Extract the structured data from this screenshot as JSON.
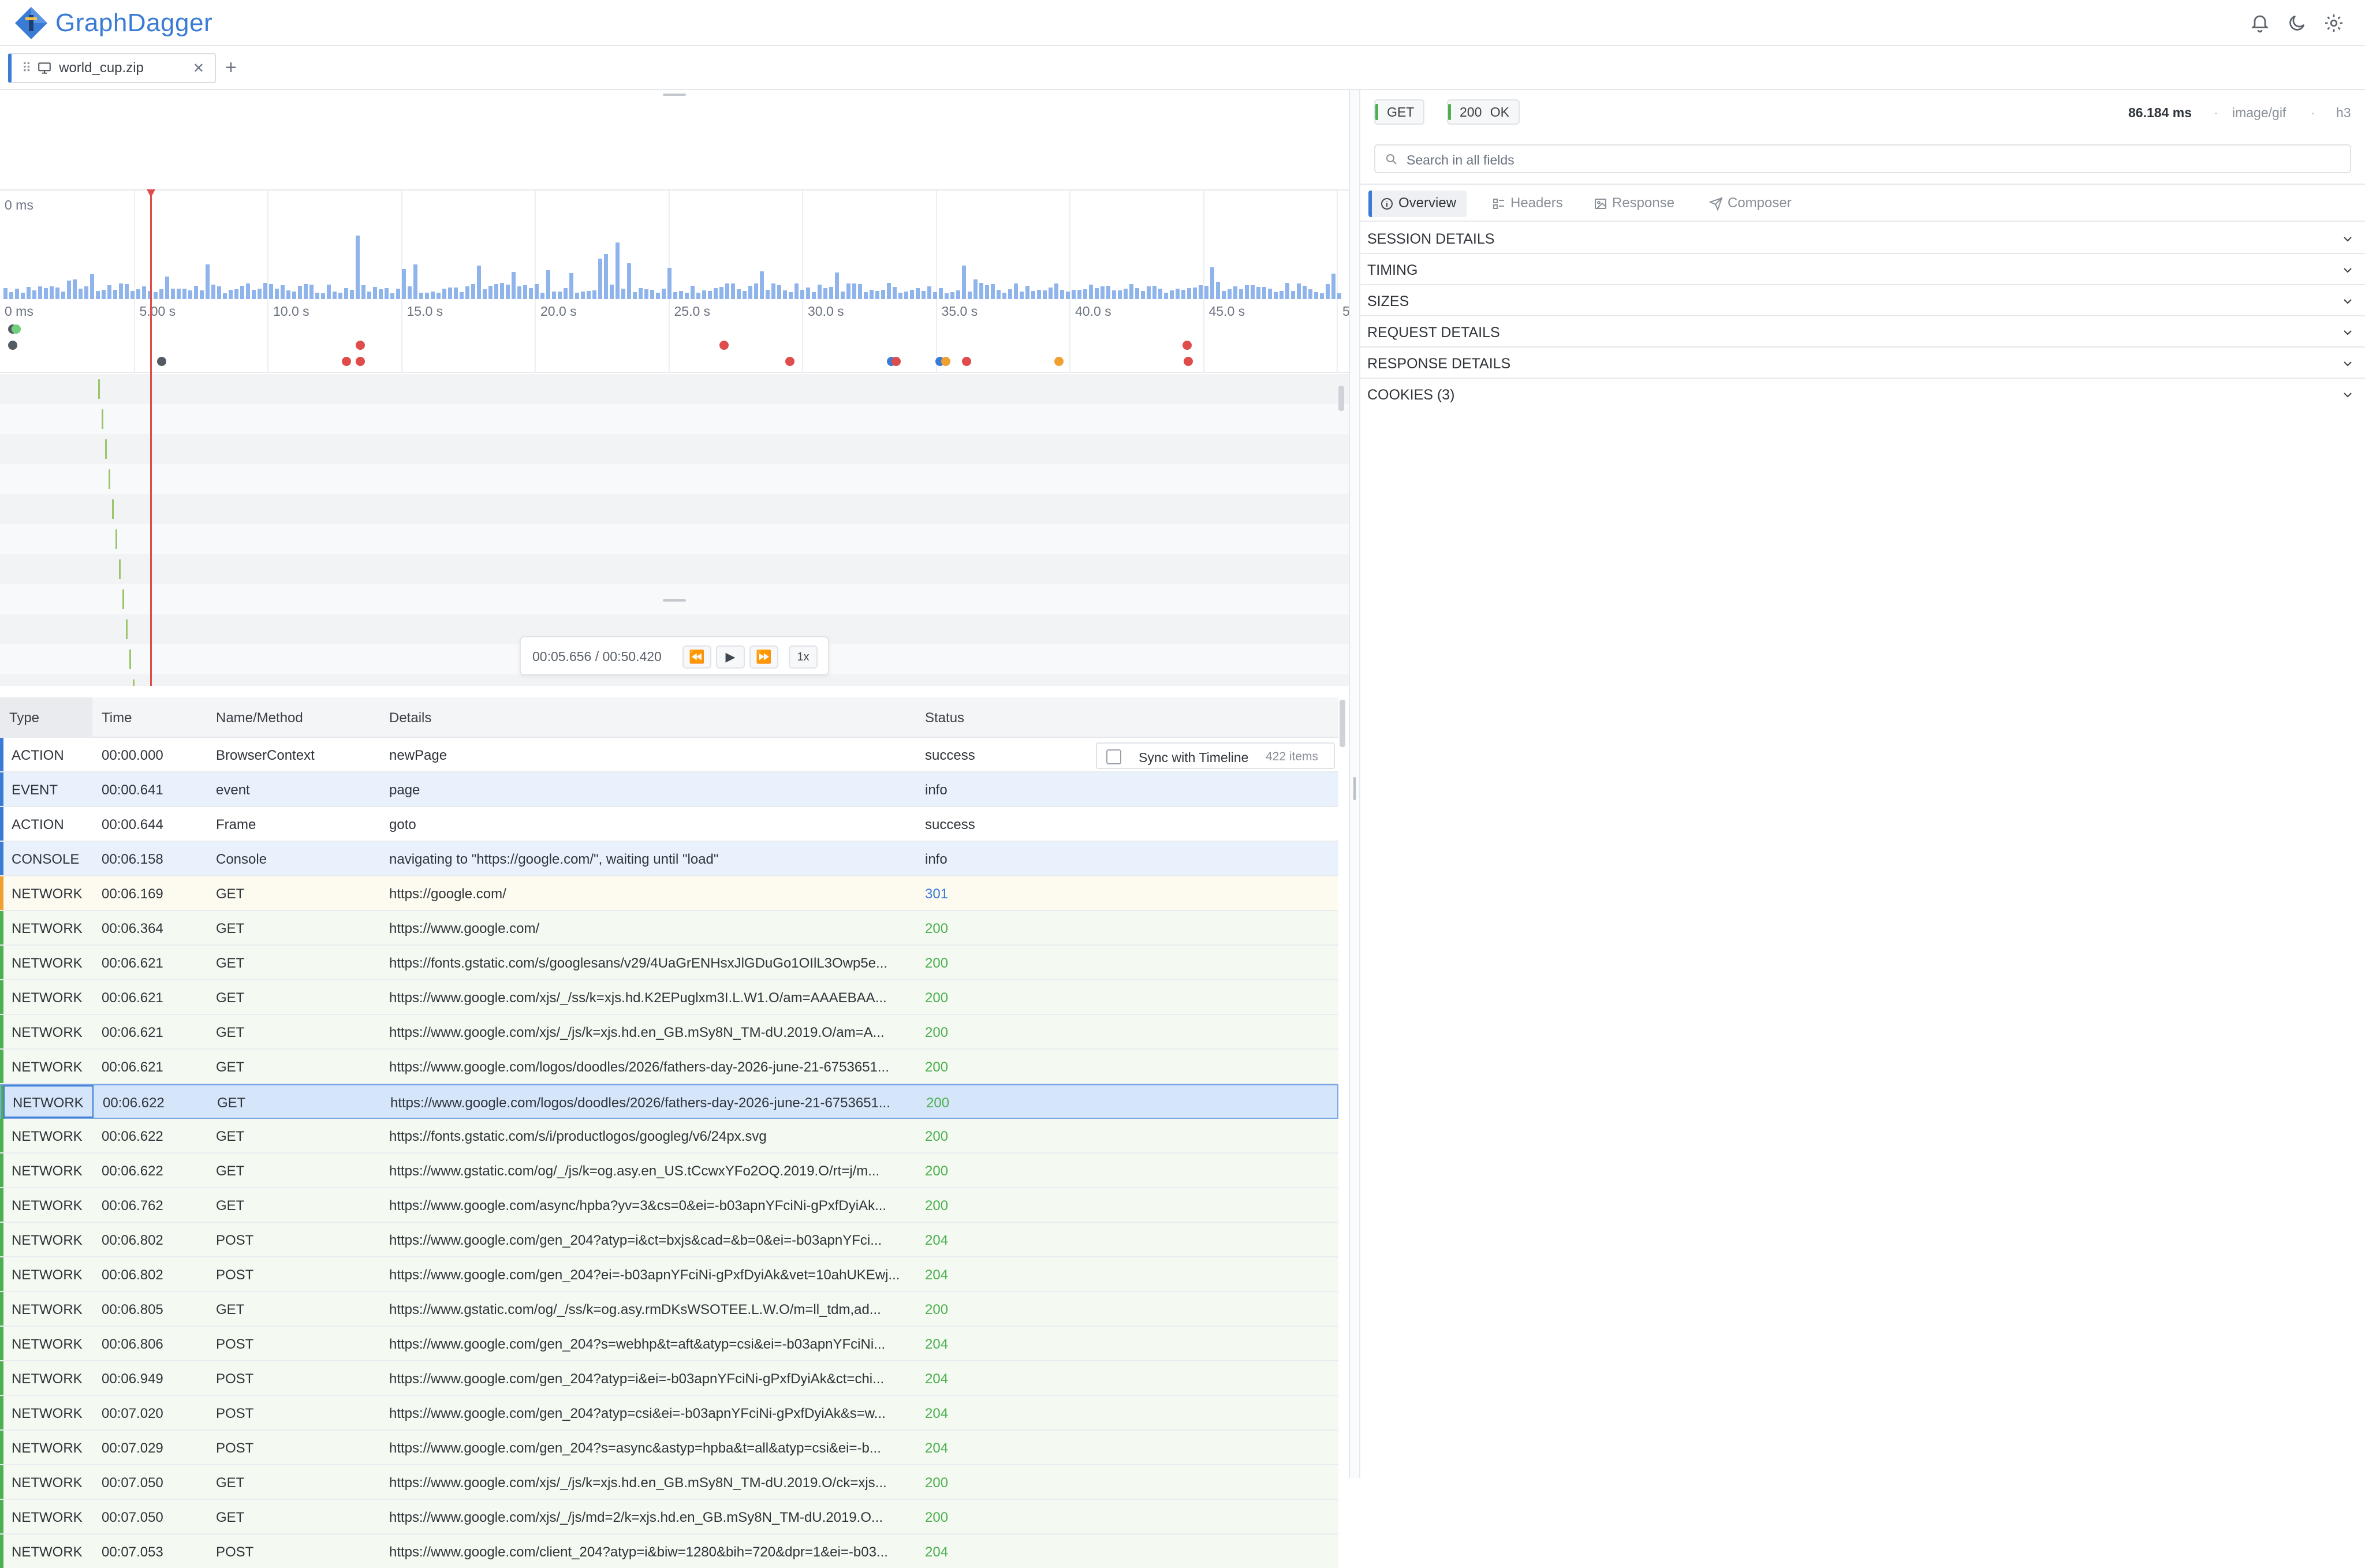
{
  "app": {
    "name": "GraphDagger"
  },
  "header_icons": [
    "bell-icon",
    "moon-icon",
    "gear-icon"
  ],
  "file_tab": {
    "label": "world_cup.zip"
  },
  "timeline": {
    "top_label": "0 ms",
    "ticks": [
      "0 ms",
      "5.00 s",
      "10.0 s",
      "15.0 s",
      "20.0 s",
      "25.0 s",
      "30.0 s",
      "35.0 s",
      "40.0 s",
      "45.0 s",
      "5"
    ]
  },
  "player": {
    "time": "00:05.656 / 00:50.420",
    "speed": "1x"
  },
  "table": {
    "columns": [
      "Type",
      "Time",
      "Name/Method",
      "Details",
      "Status"
    ],
    "sync_label": "Sync with Timeline",
    "items_count": "422 items",
    "rows": [
      {
        "type": "ACTION",
        "time": "00:00.000",
        "name": "BrowserContext",
        "details": "newPage",
        "status": "success"
      },
      {
        "type": "EVENT",
        "time": "00:00.641",
        "name": "event",
        "details": "page",
        "status": "info"
      },
      {
        "type": "ACTION",
        "time": "00:00.644",
        "name": "Frame",
        "details": "goto",
        "status": "success"
      },
      {
        "type": "CONSOLE",
        "time": "00:06.158",
        "name": "Console",
        "details": "navigating to \"https://google.com/\", waiting until \"load\"",
        "status": "info"
      },
      {
        "type": "NETWORK",
        "time": "00:06.169",
        "name": "GET",
        "details": "https://google.com/",
        "status": "301"
      },
      {
        "type": "NETWORK",
        "time": "00:06.364",
        "name": "GET",
        "details": "https://www.google.com/",
        "status": "200"
      },
      {
        "type": "NETWORK",
        "time": "00:06.621",
        "name": "GET",
        "details": "https://fonts.gstatic.com/s/googlesans/v29/4UaGrENHsxJlGDuGo1OIlL3Owp5e...",
        "status": "200"
      },
      {
        "type": "NETWORK",
        "time": "00:06.621",
        "name": "GET",
        "details": "https://www.google.com/xjs/_/ss/k=xjs.hd.K2EPuglxm3I.L.W1.O/am=AAAEBAA...",
        "status": "200"
      },
      {
        "type": "NETWORK",
        "time": "00:06.621",
        "name": "GET",
        "details": "https://www.google.com/xjs/_/js/k=xjs.hd.en_GB.mSy8N_TM-dU.2019.O/am=A...",
        "status": "200"
      },
      {
        "type": "NETWORK",
        "time": "00:06.621",
        "name": "GET",
        "details": "https://www.google.com/logos/doodles/2026/fathers-day-2026-june-21-6753651...",
        "status": "200"
      },
      {
        "type": "NETWORK",
        "time": "00:06.622",
        "name": "GET",
        "details": "https://www.google.com/logos/doodles/2026/fathers-day-2026-june-21-6753651...",
        "status": "200"
      },
      {
        "type": "NETWORK",
        "time": "00:06.622",
        "name": "GET",
        "details": "https://fonts.gstatic.com/s/i/productlogos/googleg/v6/24px.svg",
        "status": "200"
      },
      {
        "type": "NETWORK",
        "time": "00:06.622",
        "name": "GET",
        "details": "https://www.gstatic.com/og/_/js/k=og.asy.en_US.tCcwxYFo2OQ.2019.O/rt=j/m...",
        "status": "200"
      },
      {
        "type": "NETWORK",
        "time": "00:06.762",
        "name": "GET",
        "details": "https://www.google.com/async/hpba?yv=3&cs=0&ei=-b03apnYFciNi-gPxfDyiAk...",
        "status": "200"
      },
      {
        "type": "NETWORK",
        "time": "00:06.802",
        "name": "POST",
        "details": "https://www.google.com/gen_204?atyp=i&ct=bxjs&cad=&b=0&ei=-b03apnYFci...",
        "status": "204"
      },
      {
        "type": "NETWORK",
        "time": "00:06.802",
        "name": "POST",
        "details": "https://www.google.com/gen_204?ei=-b03apnYFciNi-gPxfDyiAk&vet=10ahUKEwj...",
        "status": "204"
      },
      {
        "type": "NETWORK",
        "time": "00:06.805",
        "name": "GET",
        "details": "https://www.gstatic.com/og/_/ss/k=og.asy.rmDKsWSOTEE.L.W.O/m=ll_tdm,ad...",
        "status": "200"
      },
      {
        "type": "NETWORK",
        "time": "00:06.806",
        "name": "POST",
        "details": "https://www.google.com/gen_204?s=webhp&t=aft&atyp=csi&ei=-b03apnYFciNi...",
        "status": "204"
      },
      {
        "type": "NETWORK",
        "time": "00:06.949",
        "name": "POST",
        "details": "https://www.google.com/gen_204?atyp=i&ei=-b03apnYFciNi-gPxfDyiAk&ct=chi...",
        "status": "204"
      },
      {
        "type": "NETWORK",
        "time": "00:07.020",
        "name": "POST",
        "details": "https://www.google.com/gen_204?atyp=csi&ei=-b03apnYFciNi-gPxfDyiAk&s=w...",
        "status": "204"
      },
      {
        "type": "NETWORK",
        "time": "00:07.029",
        "name": "POST",
        "details": "https://www.google.com/gen_204?s=async&astyp=hpba&t=all&atyp=csi&ei=-b...",
        "status": "204"
      },
      {
        "type": "NETWORK",
        "time": "00:07.050",
        "name": "GET",
        "details": "https://www.google.com/xjs/_/js/k=xjs.hd.en_GB.mSy8N_TM-dU.2019.O/ck=xjs...",
        "status": "200"
      },
      {
        "type": "NETWORK",
        "time": "00:07.050",
        "name": "GET",
        "details": "https://www.google.com/xjs/_/js/md=2/k=xjs.hd.en_GB.mSy8N_TM-dU.2019.O...",
        "status": "200"
      },
      {
        "type": "NETWORK",
        "time": "00:07.053",
        "name": "POST",
        "details": "https://www.google.com/client_204?atyp=i&biw=1280&bih=720&dpr=1&ei=-b03...",
        "status": "204"
      }
    ]
  },
  "detail": {
    "method": "GET",
    "status_code": "200",
    "status_text": "OK",
    "duration": "86.184 ms",
    "mime": "image/gif",
    "protocol": "h3",
    "search_placeholder": "Search in all fields",
    "tabs": [
      "Overview",
      "Headers",
      "Response",
      "Composer"
    ],
    "sections": [
      "SESSION DETAILS",
      "TIMING",
      "SIZES",
      "REQUEST DETAILS",
      "RESPONSE DETAILS",
      "COOKIES (3)"
    ]
  },
  "colors": {
    "accent": "#3a7bd5",
    "error": "#e04b4b",
    "success": "#4caf50",
    "redirect": "#f0a030",
    "bars": "#8fb4ec"
  }
}
